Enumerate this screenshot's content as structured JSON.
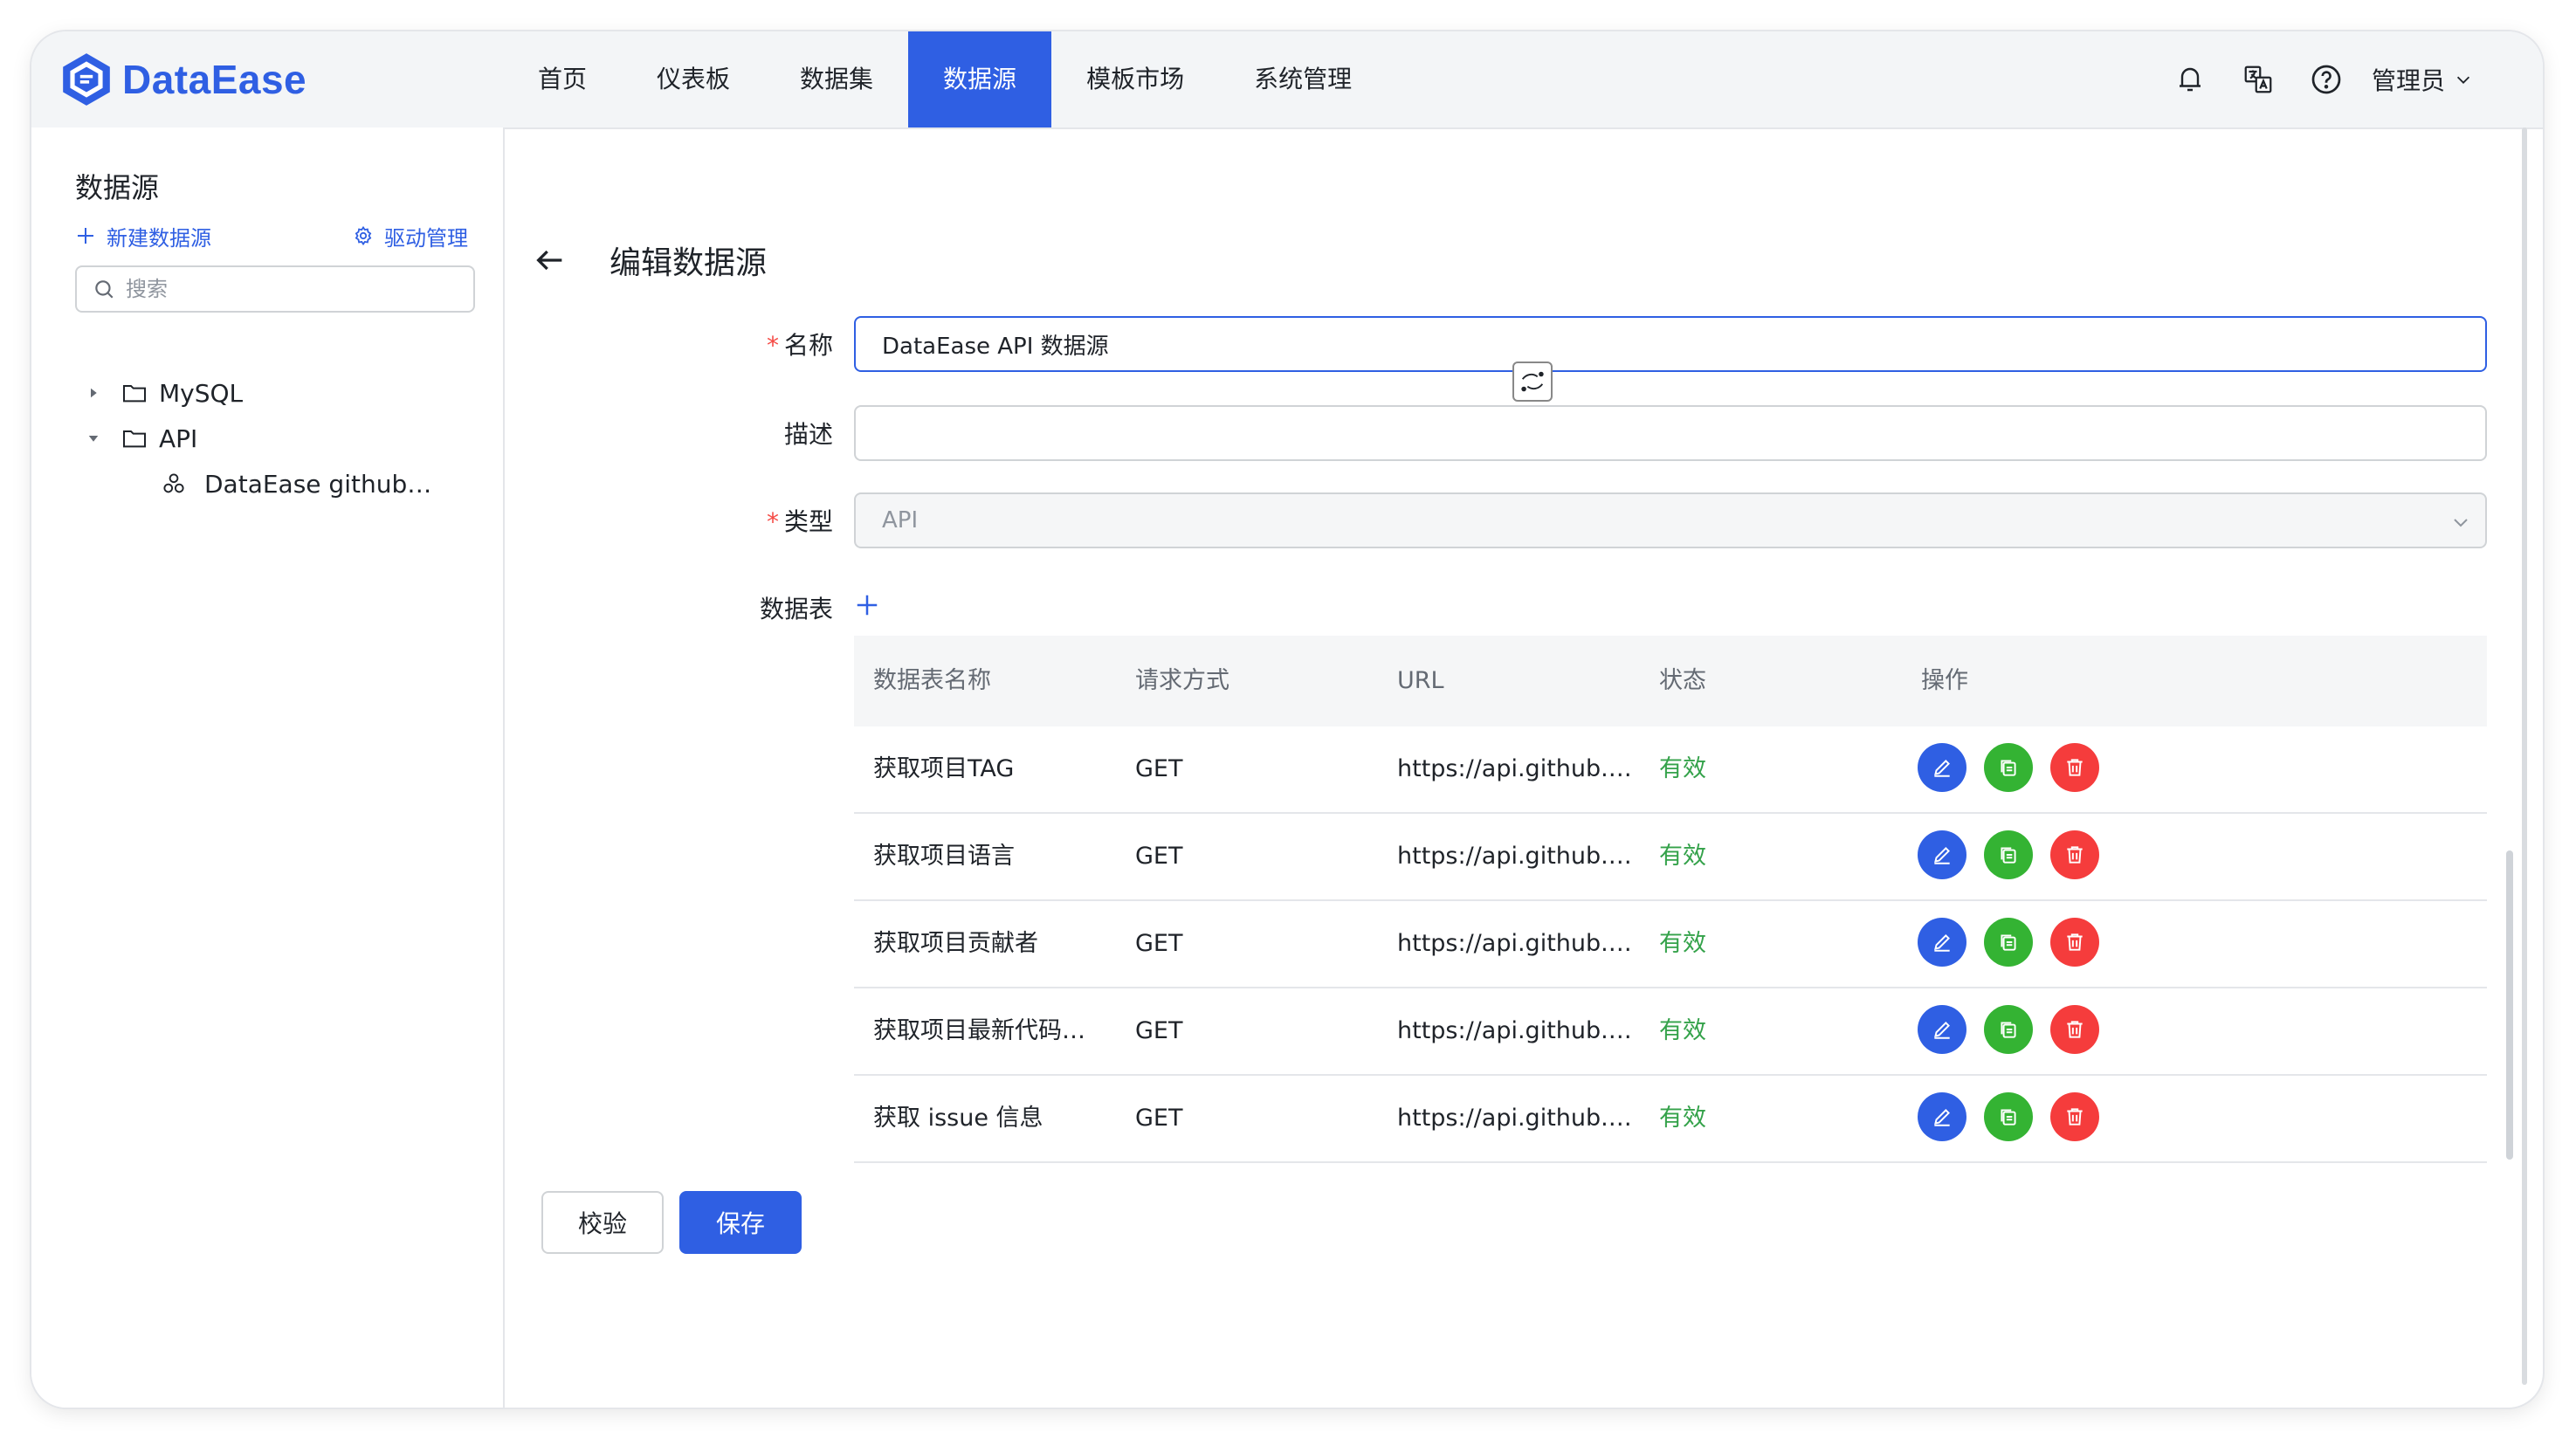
{
  "app": {
    "brand": "DataEase",
    "brand_color": "#2f5fe3"
  },
  "nav": {
    "items": [
      {
        "label": "首页",
        "active": false
      },
      {
        "label": "仪表板",
        "active": false
      },
      {
        "label": "数据集",
        "active": false
      },
      {
        "label": "数据源",
        "active": true
      },
      {
        "label": "模板市场",
        "active": false
      },
      {
        "label": "系统管理",
        "active": false
      }
    ]
  },
  "header_tools": {
    "icons": [
      "bell-icon",
      "translate-icon",
      "help-icon"
    ],
    "user": "管理员"
  },
  "sidebar": {
    "title": "数据源",
    "new_label": "新建数据源",
    "driver_label": "驱动管理",
    "search_placeholder": "搜索",
    "tree": [
      {
        "label": "MySQL",
        "expanded": false,
        "type": "folder"
      },
      {
        "label": "API",
        "expanded": true,
        "type": "folder"
      },
      {
        "label": "DataEase github…",
        "type": "datasource"
      }
    ]
  },
  "form": {
    "page_title": "编辑数据源",
    "name_label": "名称",
    "name_value": "DataEase API 数据源",
    "desc_label": "描述",
    "desc_value": "",
    "type_label": "类型",
    "type_value": "API",
    "tables_label": "数据表",
    "required_mark": "*"
  },
  "table": {
    "columns": [
      "数据表名称",
      "请求方式",
      "URL",
      "状态",
      "操作"
    ],
    "rows": [
      {
        "name": "获取项目TAG",
        "method": "GET",
        "url": "https://api.github.…",
        "status": "有效"
      },
      {
        "name": "获取项目语言",
        "method": "GET",
        "url": "https://api.github.…",
        "status": "有效"
      },
      {
        "name": "获取项目贡献者",
        "method": "GET",
        "url": "https://api.github.…",
        "status": "有效"
      },
      {
        "name": "获取项目最新代码…",
        "method": "GET",
        "url": "https://api.github.…",
        "status": "有效"
      },
      {
        "name": "获取 issue 信息",
        "method": "GET",
        "url": "https://api.github.…",
        "status": "有效"
      }
    ],
    "status_color": "#34a24a"
  },
  "buttons": {
    "validate": "校验",
    "save": "保存"
  }
}
